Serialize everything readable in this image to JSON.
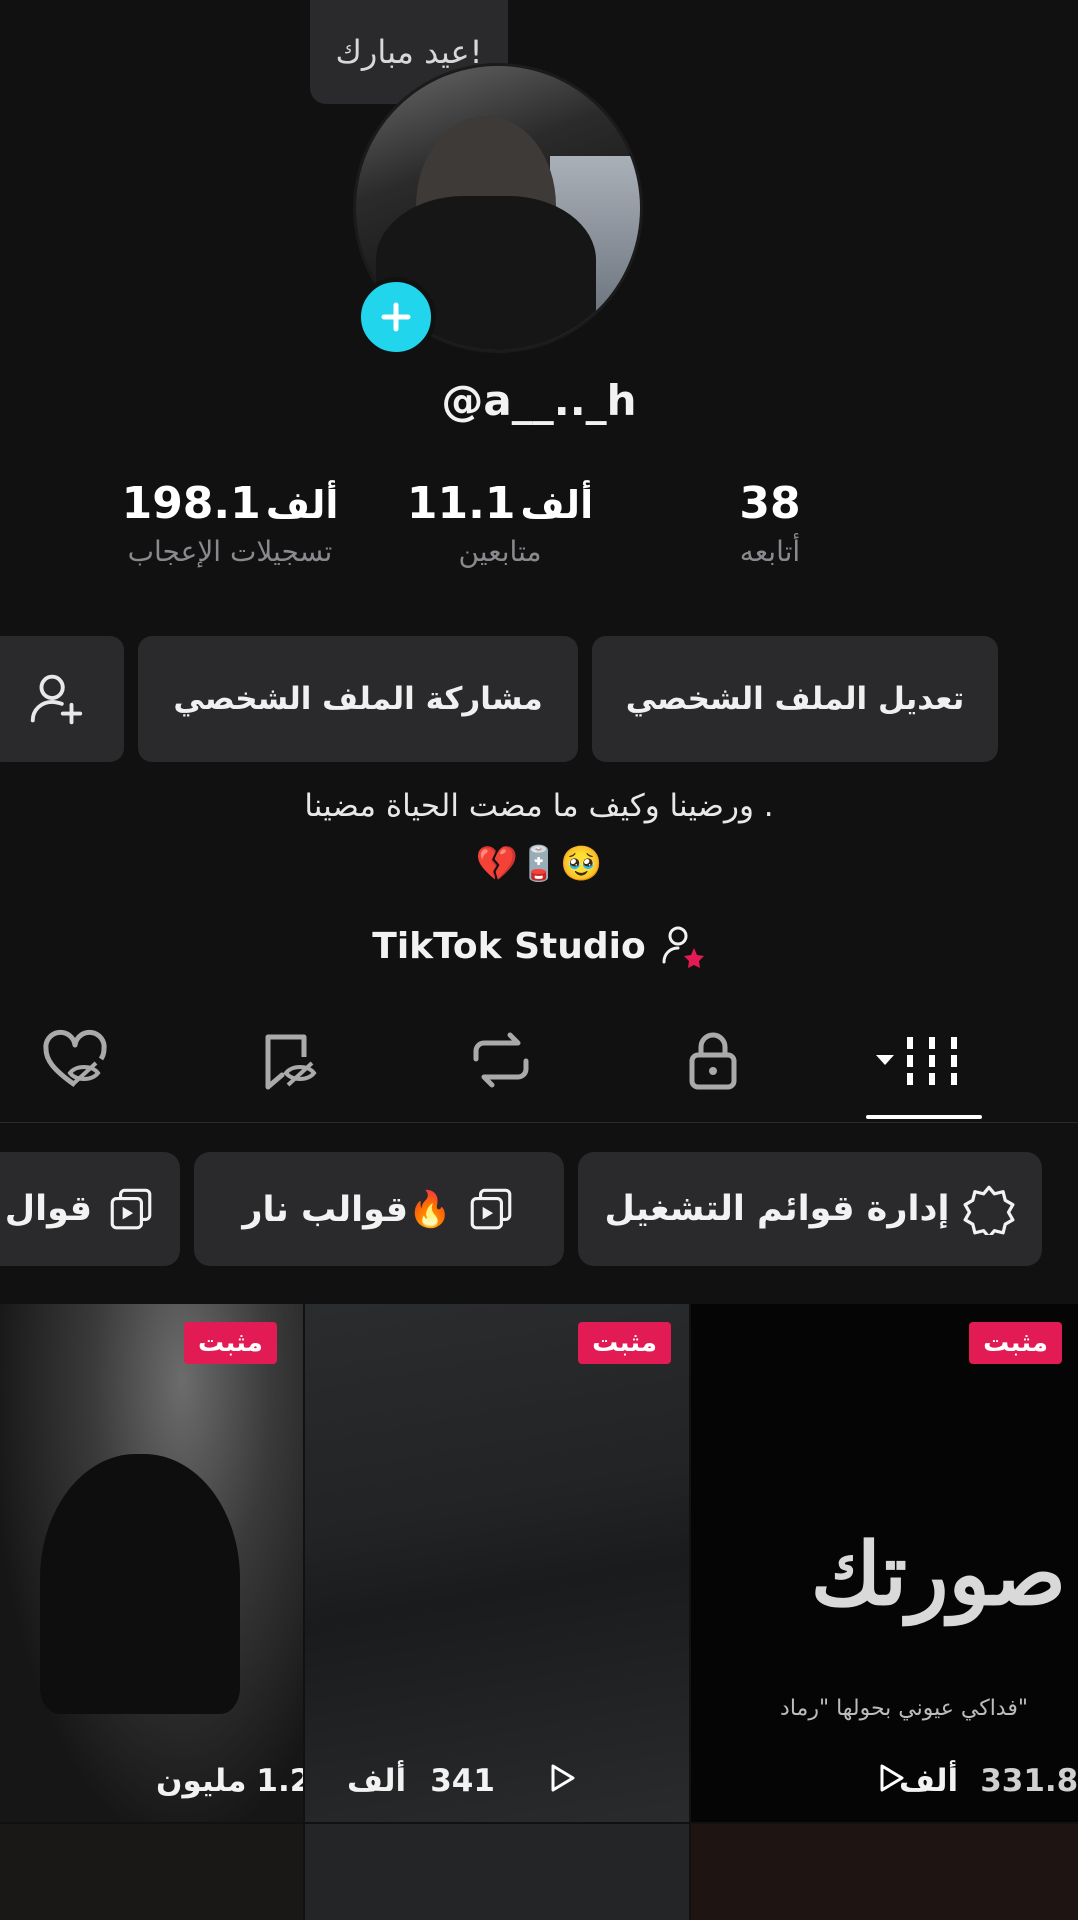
{
  "tooltip": {
    "text": "عيد مبارك!"
  },
  "profile": {
    "username": "@a__.._h"
  },
  "stats": [
    {
      "value": "38",
      "unit": "",
      "label": "أتابعه"
    },
    {
      "value": "11.1",
      "unit": "ألف",
      "label": "متابعين"
    },
    {
      "value": "198.1",
      "unit": "ألف",
      "label": "تسجيلات الإعجاب"
    }
  ],
  "buttons": {
    "edit_profile": "تعديل الملف الشخصي",
    "share_profile": "مشاركة الملف الشخصي"
  },
  "bio": {
    "line1": "ورضينا وكيف ما مضت الحياة مضينا .",
    "line2": "💔🪫🥹"
  },
  "studio": {
    "label": "TikTok Studio"
  },
  "tabs": [
    "videos-grid",
    "private",
    "reposts",
    "favorites",
    "liked"
  ],
  "chips": {
    "manage_playlists": "إدارة قوائم التشغيل",
    "fire_templates": "قوالب نار🔥",
    "templates_partial": "قوال"
  },
  "videos": [
    {
      "pinned": "مثبت",
      "views": "331.8",
      "unit": "ألف",
      "overlay_title": "صورتك",
      "overlay_caption": "فداكي عيوني بحولها \"رماد\""
    },
    {
      "pinned": "مثبت",
      "views": "341",
      "unit": "ألف"
    },
    {
      "pinned": "مثبت",
      "views": "1.2",
      "unit": "مليون"
    }
  ],
  "colors": {
    "accent": "#20d5ec",
    "pin": "#e31b54",
    "background": "#111112",
    "surface": "#2a2a2c"
  }
}
